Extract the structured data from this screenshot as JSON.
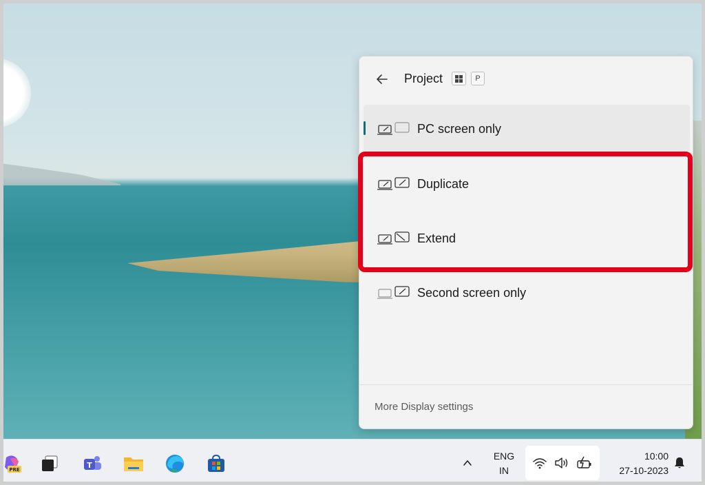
{
  "window": {
    "title": "Project",
    "shortcut_keys": [
      "⊞",
      "P"
    ]
  },
  "options": [
    {
      "label": "PC screen only",
      "selected": true,
      "icon": "pc-screen-only-icon"
    },
    {
      "label": "Duplicate",
      "selected": false,
      "icon": "duplicate-icon"
    },
    {
      "label": "Extend",
      "selected": false,
      "icon": "extend-icon"
    },
    {
      "label": "Second screen only",
      "selected": false,
      "icon": "second-screen-only-icon"
    }
  ],
  "footer": {
    "more_settings": "More Display settings"
  },
  "taskbar": {
    "apps": [
      "copilot-pre-icon",
      "task-view-icon",
      "teams-icon",
      "file-explorer-icon",
      "edge-icon",
      "store-icon"
    ],
    "language": {
      "line1": "ENG",
      "line2": "IN"
    },
    "tray_icons": [
      "wifi-icon",
      "volume-icon",
      "battery-icon"
    ],
    "clock": {
      "time": "10:00",
      "date": "27-10-2023"
    }
  },
  "colors": {
    "accent": "#0f6e74",
    "highlight": "#e3001b",
    "panel_bg": "#f3f3f3"
  }
}
